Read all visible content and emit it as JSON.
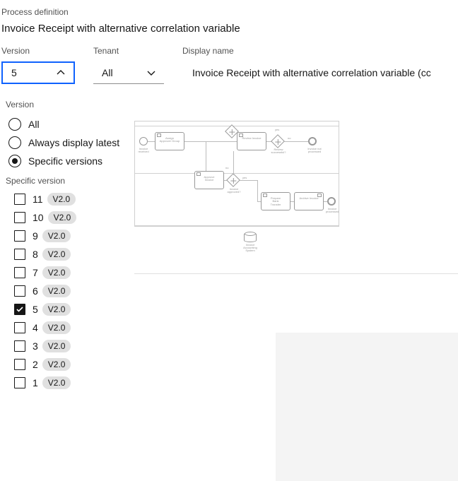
{
  "header": {
    "process_definition_label": "Process definition",
    "title": "Invoice Receipt with alternative correlation variable"
  },
  "controls": {
    "version": {
      "label": "Version",
      "value": "5"
    },
    "tenant": {
      "label": "Tenant",
      "value": "All"
    },
    "display_name": {
      "label": "Display name",
      "value": "Invoice Receipt with alternative correlation variable (cc"
    }
  },
  "dropdown_panel": {
    "section_label": "Version",
    "radios": [
      {
        "label": "All",
        "selected": false
      },
      {
        "label": "Always display latest",
        "selected": false
      },
      {
        "label": "Specific versions",
        "selected": true
      }
    ],
    "specific_label": "Specific version",
    "versions": [
      {
        "num": "11",
        "badge": "V2.0",
        "checked": false
      },
      {
        "num": "10",
        "badge": "V2.0",
        "checked": false
      },
      {
        "num": "9",
        "badge": "V2.0",
        "checked": false
      },
      {
        "num": "8",
        "badge": "V2.0",
        "checked": false
      },
      {
        "num": "7",
        "badge": "V2.0",
        "checked": false
      },
      {
        "num": "6",
        "badge": "V2.0",
        "checked": false
      },
      {
        "num": "5",
        "badge": "V2.0",
        "checked": true
      },
      {
        "num": "4",
        "badge": "V2.0",
        "checked": false
      },
      {
        "num": "3",
        "badge": "V2.0",
        "checked": false
      },
      {
        "num": "2",
        "badge": "V2.0",
        "checked": false
      },
      {
        "num": "1",
        "badge": "V2.0",
        "checked": false
      }
    ]
  },
  "diagram": {
    "events": {
      "start_label": "Invoice\nreceived",
      "end1_label": "Invoice not\nprocessed",
      "end2_label": "Invoice\nprocessed"
    },
    "tasks": {
      "assign": "Assign\nApprover Group",
      "approve": "Approve\nInvoice",
      "review": "Review Invoice",
      "prepare": "Prepare\nBank\nTransfer",
      "archive": "Archive Invoice"
    },
    "gateways": {
      "approved_label": "Invoice\napproved?",
      "reviewed_label": "Review\nsuccessful?",
      "yes": "yes",
      "no": "no"
    },
    "datastore": "Invoice\nAccounting\nSystem"
  }
}
